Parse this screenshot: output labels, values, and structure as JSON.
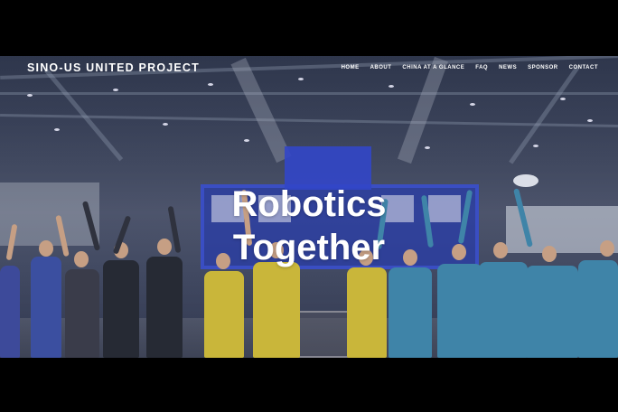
{
  "header": {
    "site_title": "SINO-US UNITED PROJECT"
  },
  "nav": {
    "items": [
      {
        "label": "HOME"
      },
      {
        "label": "ABOUT"
      },
      {
        "label": "CHINA AT A GLANCE"
      },
      {
        "label": "FAQ"
      },
      {
        "label": "NEWS"
      },
      {
        "label": "SPONSOR"
      },
      {
        "label": "CONTACT"
      }
    ]
  },
  "hero": {
    "headline_line1": "Robotics",
    "headline_line2": "Together",
    "image_description_icon": "photo-background",
    "overlay_color": "#1c2446"
  },
  "colors": {
    "page_background": "#000000",
    "text": "#ffffff",
    "shirt_yellow": "#c9b63a",
    "lab_coat_blue": "#3f84a8",
    "arena_blue": "#2f43b0"
  }
}
